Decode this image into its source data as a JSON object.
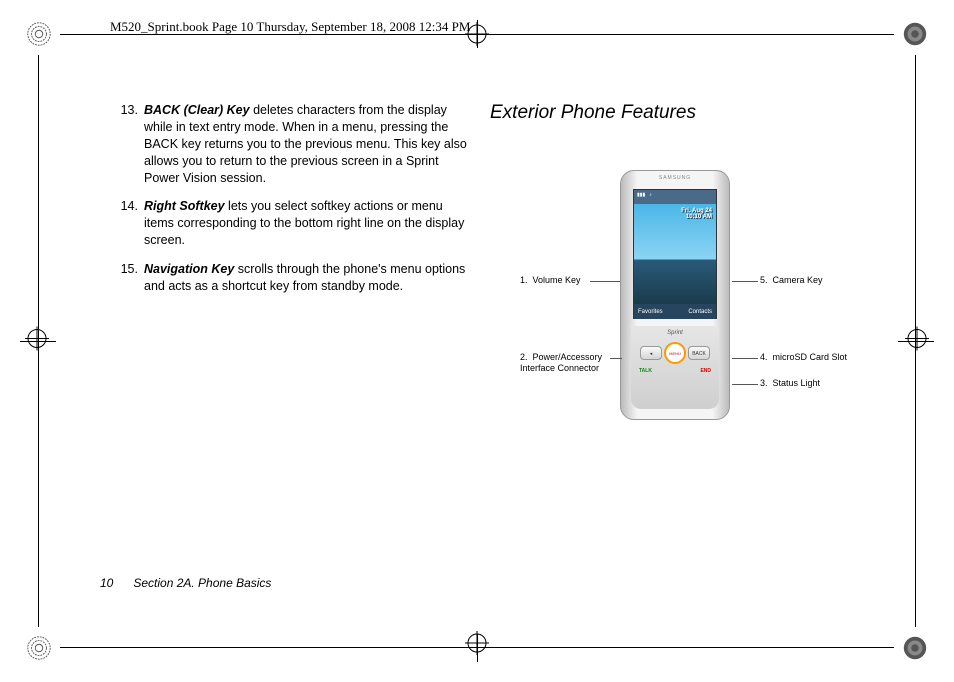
{
  "book_header": "M520_Sprint.book  Page 10  Thursday, September 18, 2008  12:34 PM",
  "list": {
    "item13": {
      "num": "13.",
      "term": "BACK (Clear) Key",
      "text": " deletes characters from the display while in text entry mode. When in a menu, pressing the BACK key returns you to the previous menu. This key also allows you to return to the previous screen in a Sprint Power Vision session."
    },
    "item14": {
      "num": "14.",
      "term": "Right Softkey",
      "text": " lets you select softkey actions or menu items corresponding to the bottom right line on the display screen."
    },
    "item15": {
      "num": "15.",
      "term": "Navigation Key",
      "text": " scrolls through the phone's menu options and acts as a shortcut key from standby mode."
    }
  },
  "section_title": "Exterior Phone Features",
  "phone": {
    "brand": "SAMSUNG",
    "carrier": "Sprint",
    "date": "Fri, Aug 24",
    "time": "10:10 AM",
    "soft_left": "Favorites",
    "soft_right": "Contacts",
    "btn_back": "BACK",
    "btn_menu": "MENU",
    "btn_talk": "TALK",
    "btn_end": "END"
  },
  "callouts": {
    "c1": {
      "num": "1.",
      "label": "Volume Key"
    },
    "c2": {
      "num": "2.",
      "label": "Power/Accessory Interface Connector"
    },
    "c3": {
      "num": "3.",
      "label": "Status Light"
    },
    "c4": {
      "num": "4.",
      "label": "microSD Card Slot"
    },
    "c5": {
      "num": "5.",
      "label": "Camera Key"
    }
  },
  "footer": {
    "page": "10",
    "section": "Section 2A. Phone Basics"
  }
}
